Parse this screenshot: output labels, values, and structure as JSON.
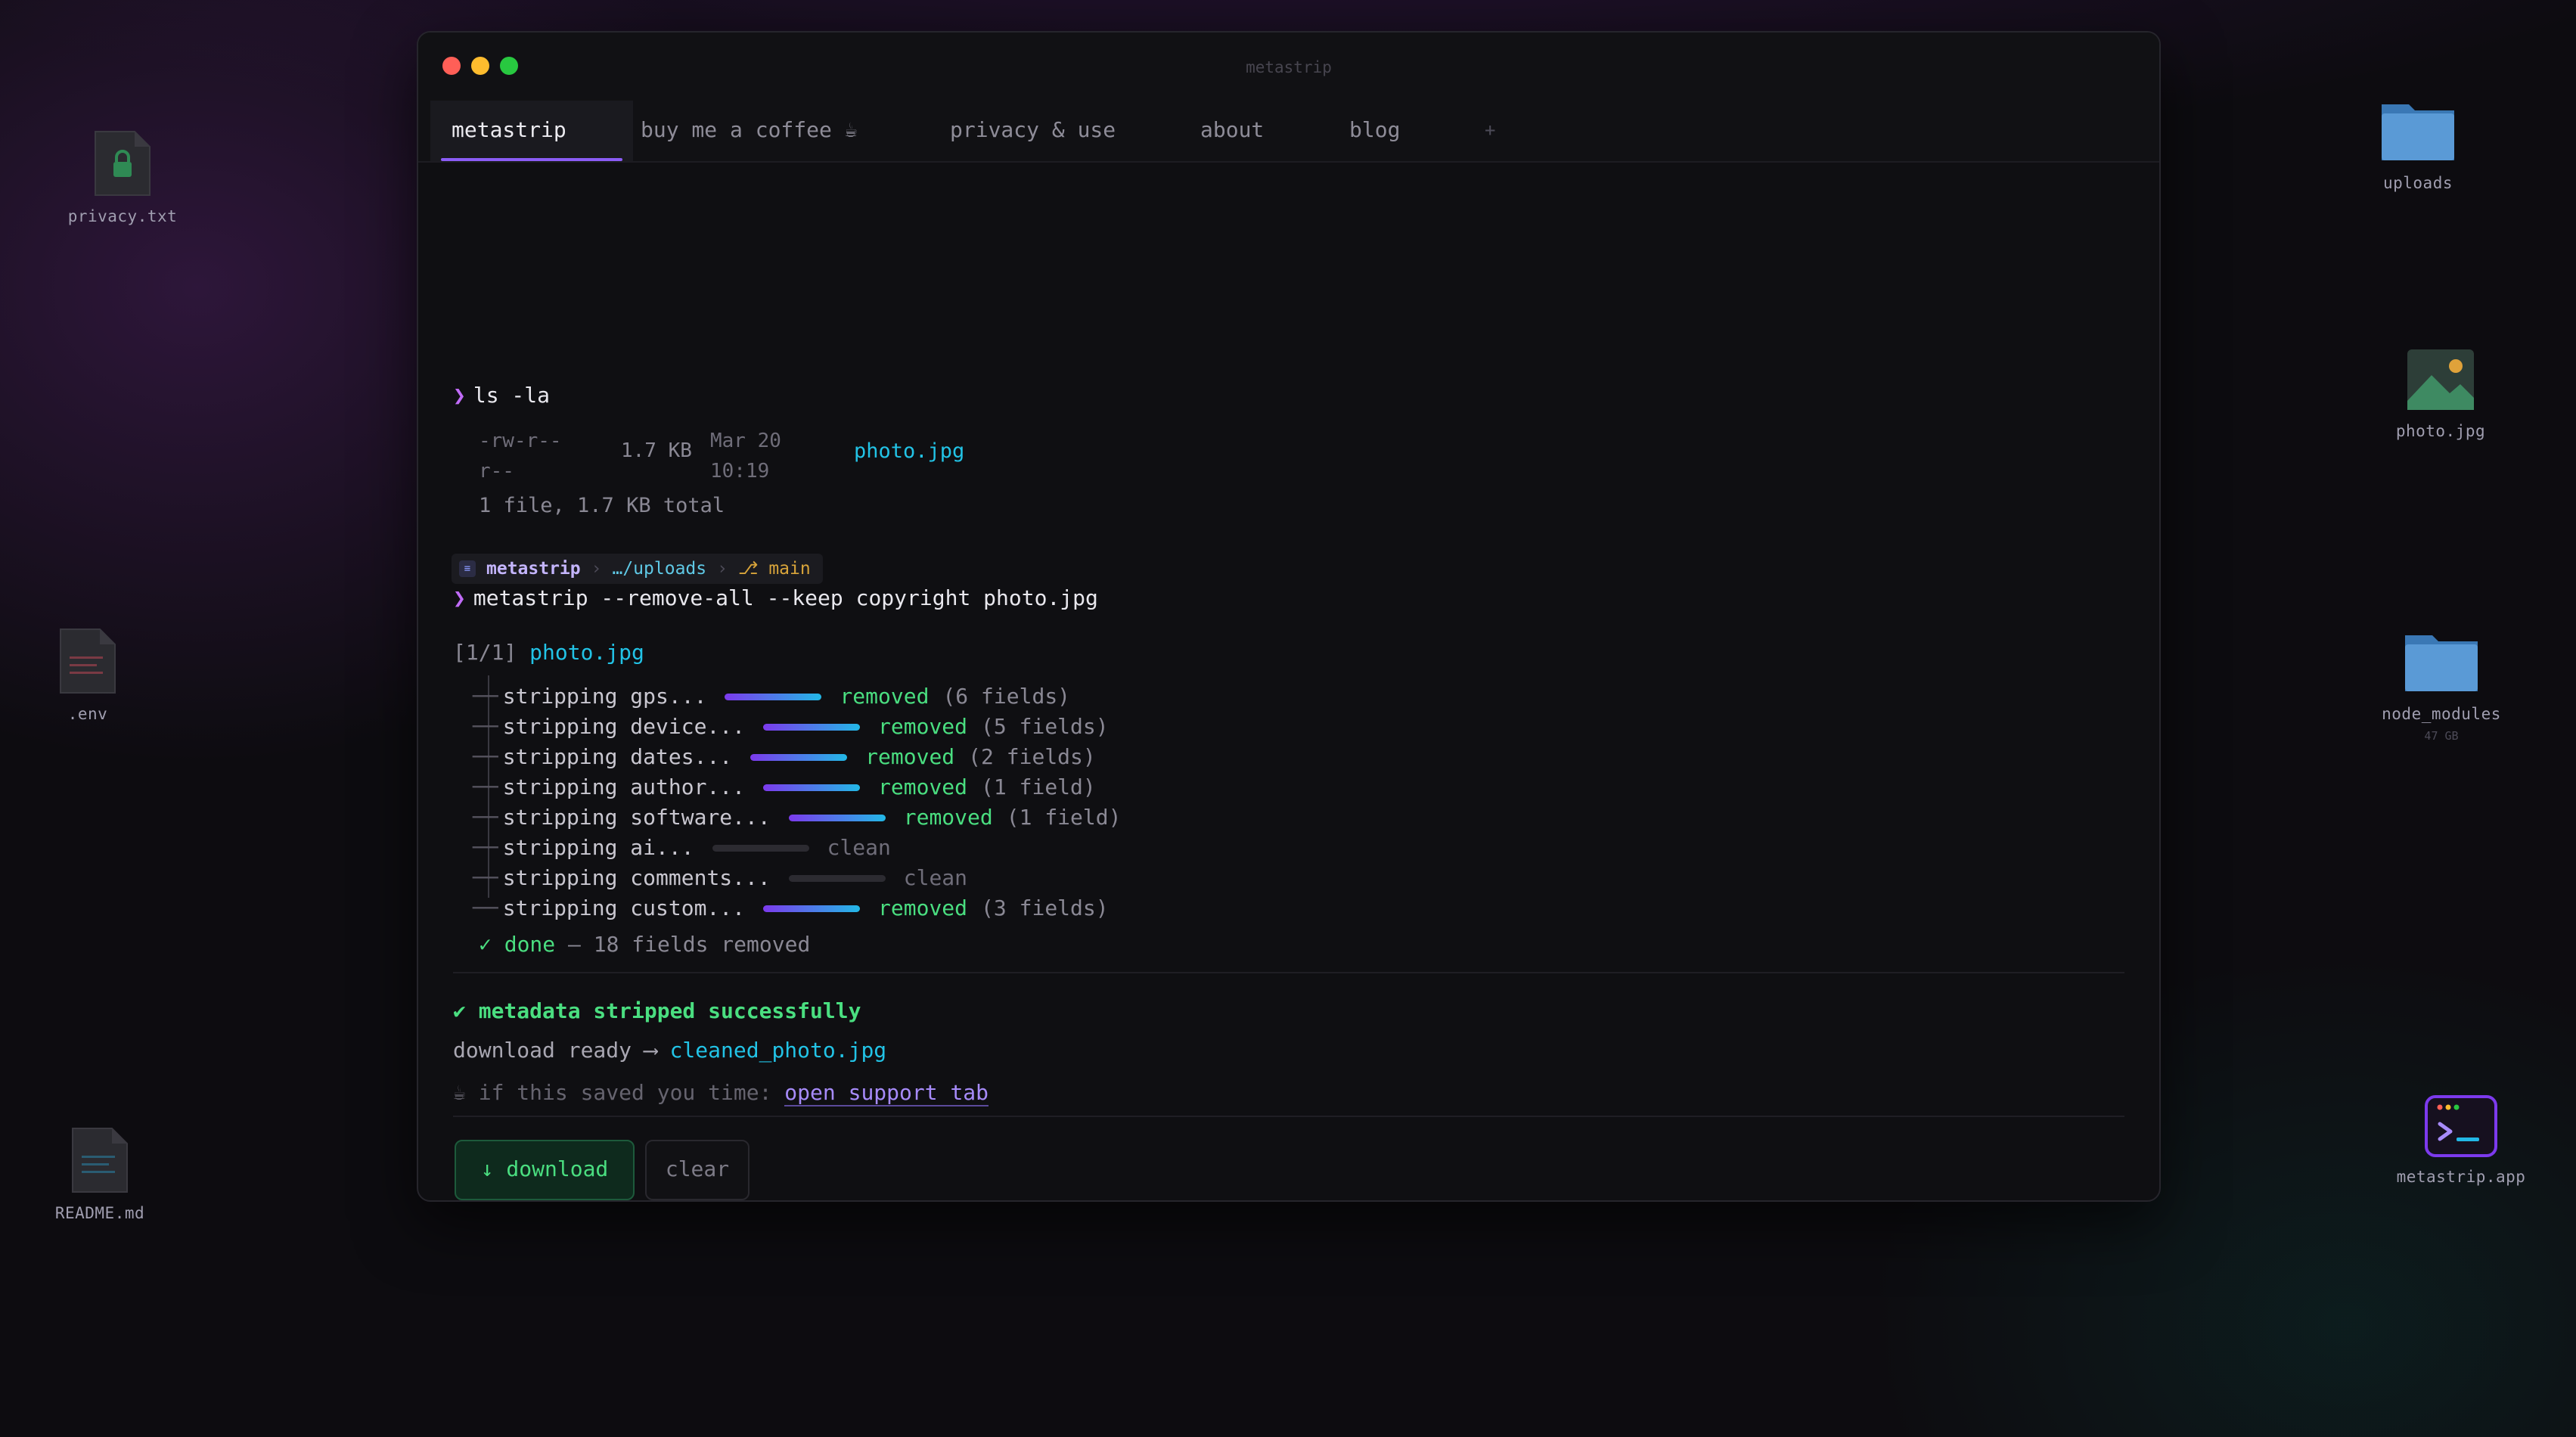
{
  "desktop": {
    "icons": [
      {
        "label": "privacy.txt",
        "kind": "lock-file"
      },
      {
        "label": ".env",
        "kind": "text-file"
      },
      {
        "label": "README.md",
        "kind": "text-file"
      },
      {
        "label": "uploads",
        "kind": "folder"
      },
      {
        "label": "photo.jpg",
        "kind": "image-file"
      },
      {
        "label": "node_modules",
        "kind": "folder",
        "sub": "47 GB"
      },
      {
        "label": "metastrip.app",
        "kind": "terminal-app"
      }
    ]
  },
  "window": {
    "title": "metastrip",
    "tabs": [
      {
        "label": "metastrip",
        "active": true
      },
      {
        "label": "buy me a coffee ☕",
        "active": false
      },
      {
        "label": "privacy & use",
        "active": false
      },
      {
        "label": "about",
        "active": false
      },
      {
        "label": "blog",
        "active": false
      },
      {
        "label": "+",
        "active": false
      }
    ]
  },
  "terminal": {
    "prompt_symbol": "❯",
    "cmd1": "ls -la",
    "listing": {
      "perms": "-rw-r--r--",
      "size": "1.7 KB",
      "date": "Mar 20 10:19",
      "file": "photo.jpg",
      "summary": "1 file, 1.7 KB total"
    },
    "breadcrumb": {
      "app": "metastrip",
      "path": "…/uploads",
      "branch": "⎇ main"
    },
    "cmd2": "metastrip --remove-all --keep copyright photo.jpg",
    "progress": {
      "counter": "[1/1]",
      "file": "photo.jpg",
      "steps": [
        {
          "label": "stripping gps...",
          "status": "removed",
          "detail": "(6 fields)",
          "done": true
        },
        {
          "label": "stripping device...",
          "status": "removed",
          "detail": "(5 fields)",
          "done": true
        },
        {
          "label": "stripping dates...",
          "status": "removed",
          "detail": "(2 fields)",
          "done": true
        },
        {
          "label": "stripping author...",
          "status": "removed",
          "detail": "(1 field)",
          "done": true
        },
        {
          "label": "stripping software...",
          "status": "removed",
          "detail": "(1 field)",
          "done": true
        },
        {
          "label": "stripping ai...",
          "status": "clean",
          "detail": "",
          "done": false
        },
        {
          "label": "stripping comments...",
          "status": "clean",
          "detail": "",
          "done": false
        },
        {
          "label": "stripping custom...",
          "status": "removed",
          "detail": "(3 fields)",
          "done": true
        }
      ],
      "done_label": "✓ done",
      "done_detail": "— 18 fields removed"
    },
    "success": "✔ metadata stripped successfully",
    "download_text": "download ready ⟶",
    "download_file": "cleaned_photo.jpg",
    "support_text": "☕ if this saved you time:",
    "support_link": "open support tab"
  },
  "buttons": {
    "download": "↓ download",
    "clear": "clear"
  },
  "colors": {
    "accent": "#8b5cf6",
    "success": "#4ade80",
    "link": "#22c3e6",
    "prompt": "#c06bf7"
  }
}
